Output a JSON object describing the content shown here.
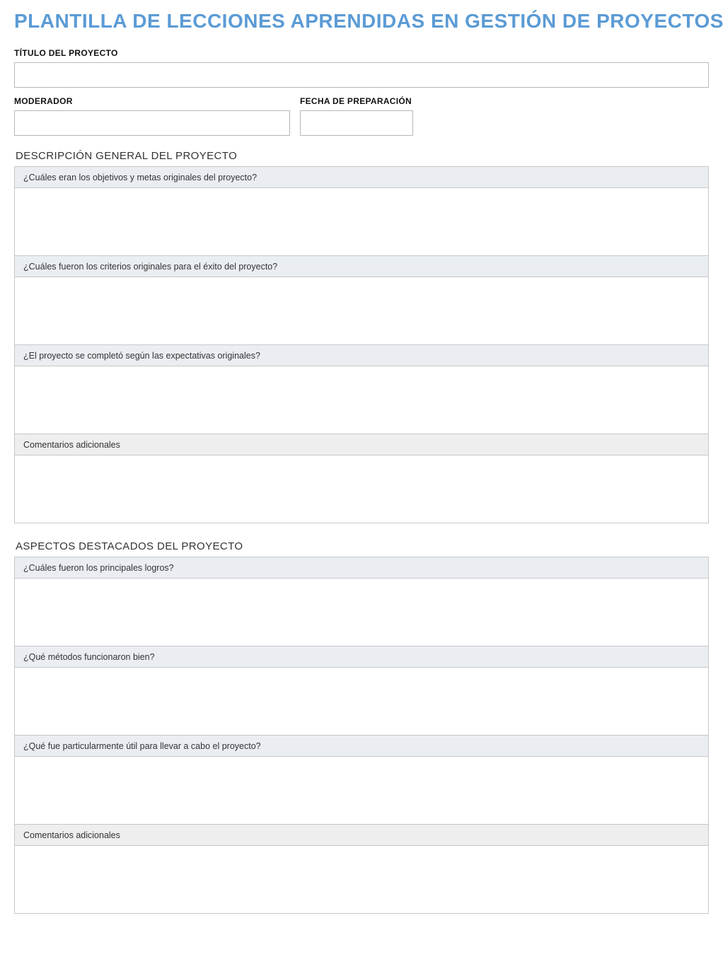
{
  "title": "PLANTILLA DE LECCIONES APRENDIDAS EN GESTIÓN DE PROYECTOS",
  "fields": {
    "project_title_label": "TÍTULO DEL PROYECTO",
    "project_title_value": "",
    "moderator_label": "MODERADOR",
    "moderator_value": "",
    "prep_date_label": "FECHA DE PREPARACIÓN",
    "prep_date_value": ""
  },
  "sections": {
    "overview": {
      "heading": "DESCRIPCIÓN GENERAL DEL PROYECTO",
      "q1": "¿Cuáles eran los objetivos y metas originales del proyecto?",
      "a1": "",
      "q2": "¿Cuáles fueron los criterios originales para el éxito del proyecto?",
      "a2": "",
      "q3": "¿El proyecto se completó según las expectativas originales?",
      "a3": "",
      "q4": "Comentarios adicionales",
      "a4": ""
    },
    "highlights": {
      "heading": "ASPECTOS DESTACADOS DEL PROYECTO",
      "q1": "¿Cuáles fueron los principales logros?",
      "a1": "",
      "q2": "¿Qué métodos funcionaron bien?",
      "a2": "",
      "q3": "¿Qué fue particularmente útil para llevar a cabo el proyecto?",
      "a3": "",
      "q4": "Comentarios adicionales",
      "a4": ""
    }
  }
}
